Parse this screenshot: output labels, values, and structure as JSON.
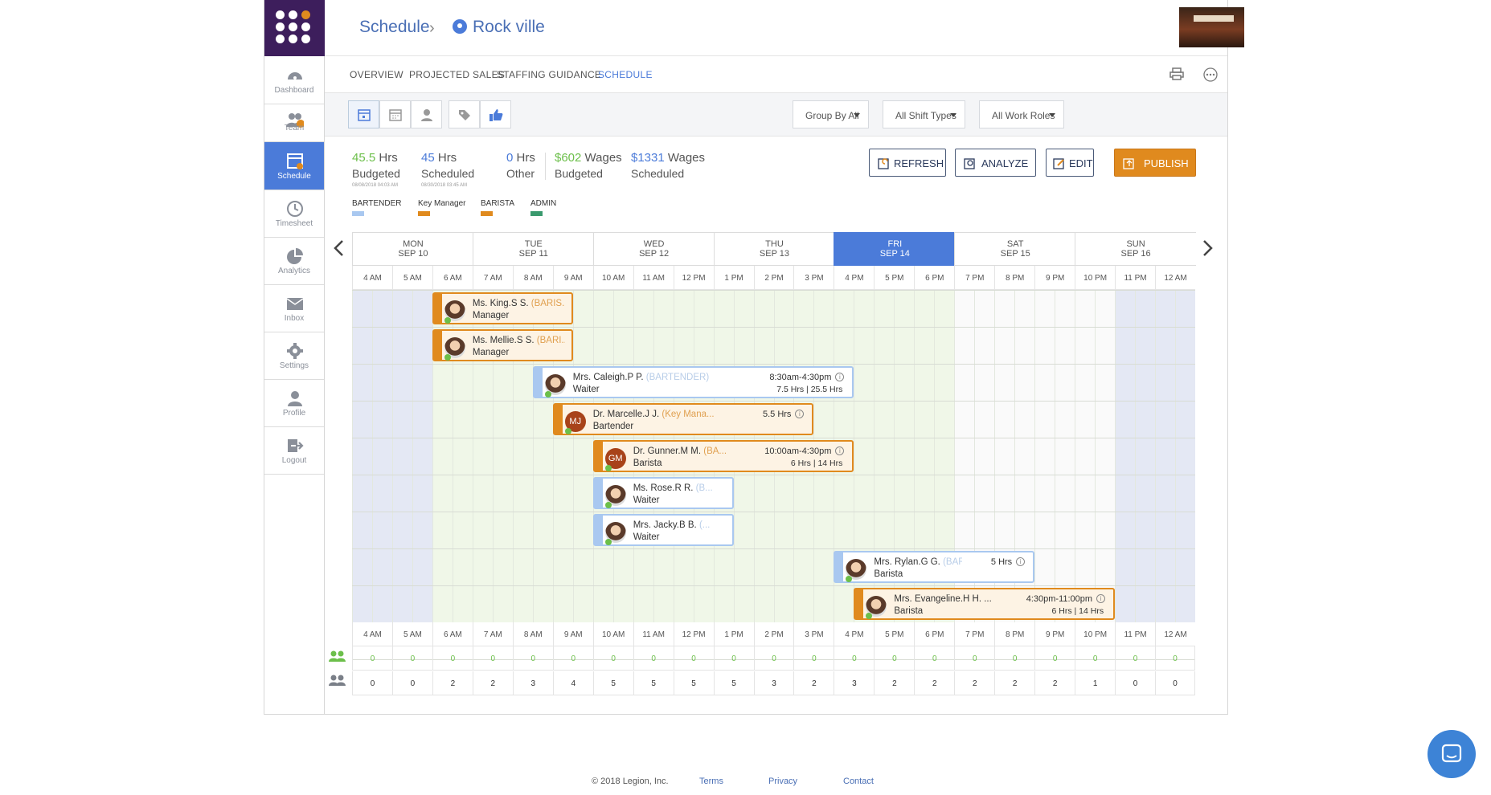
{
  "header": {
    "breadcrumb_root": "Schedule",
    "breadcrumb_location": "Rock ville"
  },
  "sidebar": {
    "items": [
      {
        "label": "Dashboard",
        "icon": "dashboard-icon"
      },
      {
        "label": "Team",
        "icon": "team-icon"
      },
      {
        "label": "Schedule",
        "icon": "schedule-icon",
        "active": true
      },
      {
        "label": "Timesheet",
        "icon": "clock-icon"
      },
      {
        "label": "Analytics",
        "icon": "pie-chart-icon"
      },
      {
        "label": "Inbox",
        "icon": "mail-icon"
      },
      {
        "label": "Settings",
        "icon": "gear-icon"
      },
      {
        "label": "Profile",
        "icon": "user-icon"
      },
      {
        "label": "Logout",
        "icon": "logout-icon"
      }
    ]
  },
  "tabs": [
    "OVERVIEW",
    "PROJECTED SALES",
    "STAFFING GUIDANCE",
    "SCHEDULE"
  ],
  "filters": {
    "group": "Group By All",
    "shift_types": "All Shift Types",
    "work_roles": "All Work Roles"
  },
  "stats": {
    "budgeted_hrs": "45.5",
    "budgeted_unit": "Hrs",
    "budgeted_label": "Budgeted",
    "budgeted_date": "08/08/2018 04:03 AM",
    "scheduled_hrs": "45",
    "scheduled_unit": "Hrs",
    "scheduled_label": "Scheduled",
    "scheduled_date": "08/30/2018 03:45 AM",
    "other_hrs": "0",
    "other_unit": "Hrs",
    "other_label": "Other",
    "wages_budgeted": "$602",
    "wages_budgeted_unit": "Wages",
    "wages_budgeted_label": "Budgeted",
    "wages_scheduled": "$1331",
    "wages_scheduled_unit": "Wages",
    "wages_scheduled_label": "Scheduled"
  },
  "actions": {
    "refresh": "REFRESH",
    "analyze": "ANALYZE",
    "edit": "EDIT",
    "publish": "PUBLISH"
  },
  "legend": [
    {
      "label": "BARTENDER",
      "color": "#a9c8f0"
    },
    {
      "label": "Key Manager",
      "color": "#e08a1e"
    },
    {
      "label": "BARISTA",
      "color": "#e08a1e"
    },
    {
      "label": "ADMIN",
      "color": "#3a9a6e"
    }
  ],
  "days": [
    {
      "dow": "MON",
      "date": "SEP 10"
    },
    {
      "dow": "TUE",
      "date": "SEP 11"
    },
    {
      "dow": "WED",
      "date": "SEP 12"
    },
    {
      "dow": "THU",
      "date": "SEP 13"
    },
    {
      "dow": "FRI",
      "date": "SEP 14",
      "today": true
    },
    {
      "dow": "SAT",
      "date": "SEP 15"
    },
    {
      "dow": "SUN",
      "date": "SEP 16"
    }
  ],
  "hours": [
    "4 AM",
    "5 AM",
    "6 AM",
    "7 AM",
    "8 AM",
    "9 AM",
    "10 AM",
    "11 AM",
    "12 PM",
    "1 PM",
    "2 PM",
    "3 PM",
    "4 PM",
    "5 PM",
    "6 PM",
    "7 PM",
    "8 PM",
    "9 PM",
    "10 PM",
    "11 PM",
    "12 AM"
  ],
  "shifts": [
    {
      "name": "Ms. King.S S.",
      "role_tag": "(BARIS...",
      "role": "Manager",
      "time": "",
      "hrs": "",
      "start": 6,
      "end": 9.5,
      "style": "orange",
      "avatar": "photo"
    },
    {
      "name": "Ms. Mellie.S S.",
      "role_tag": "(BARI...",
      "role": "Manager",
      "time": "",
      "hrs": "",
      "start": 6,
      "end": 9.5,
      "style": "orange",
      "avatar": "photo"
    },
    {
      "name": "Mrs. Caleigh.P P.",
      "role_tag": "(BARTENDER)",
      "role": "Waiter",
      "time": "8:30am-4:30pm",
      "hrs": "7.5 Hrs | 25.5 Hrs",
      "start": 8.5,
      "end": 16.5,
      "style": "blue",
      "avatar": "photo"
    },
    {
      "name": "Dr. Marcelle.J J.",
      "role_tag": "(Key Mana...",
      "role": "Bartender",
      "time": "5.5 Hrs",
      "hrs": "",
      "start": 9,
      "end": 15.5,
      "style": "orange",
      "avatar": "MJ"
    },
    {
      "name": "Dr. Gunner.M M.",
      "role_tag": "(BA...",
      "role": "Barista",
      "time": "10:00am-4:30pm",
      "hrs": "6 Hrs | 14 Hrs",
      "start": 10,
      "end": 16.5,
      "style": "orange",
      "avatar": "GM"
    },
    {
      "name": "Ms. Rose.R R.",
      "role_tag": "(B...",
      "role": "Waiter",
      "time": "",
      "hrs": "",
      "start": 10,
      "end": 13.5,
      "style": "blue",
      "avatar": "photo"
    },
    {
      "name": "Mrs. Jacky.B B.",
      "role_tag": "(...",
      "role": "Waiter",
      "time": "",
      "hrs": "",
      "start": 10,
      "end": 13.5,
      "style": "blue",
      "avatar": "photo"
    },
    {
      "name": "Mrs. Rylan.G G.",
      "role_tag": "(BARTE...",
      "role": "Barista",
      "time": "5 Hrs",
      "hrs": "",
      "start": 16,
      "end": 21,
      "style": "blue",
      "avatar": "photo"
    },
    {
      "name": "Mrs. Evangeline.H H. ...",
      "role_tag": "",
      "role": "Barista",
      "time": "4:30pm-11:00pm",
      "hrs": "6 Hrs | 14 Hrs",
      "start": 16.5,
      "end": 23,
      "style": "orange",
      "avatar": "photo"
    }
  ],
  "counts_budget": [
    "0",
    "0",
    "0",
    "0",
    "0",
    "0",
    "0",
    "0",
    "0",
    "0",
    "0",
    "0",
    "0",
    "0",
    "0",
    "0",
    "0",
    "0",
    "0",
    "0",
    "0"
  ],
  "counts_scheduled": [
    "0",
    "0",
    "2",
    "2",
    "3",
    "4",
    "5",
    "5",
    "5",
    "5",
    "3",
    "2",
    "3",
    "2",
    "2",
    "2",
    "2",
    "2",
    "1",
    "0",
    "0"
  ],
  "footer": {
    "copyright": "© 2018 Legion, Inc.",
    "terms": "Terms",
    "privacy": "Privacy",
    "contact": "Contact"
  }
}
